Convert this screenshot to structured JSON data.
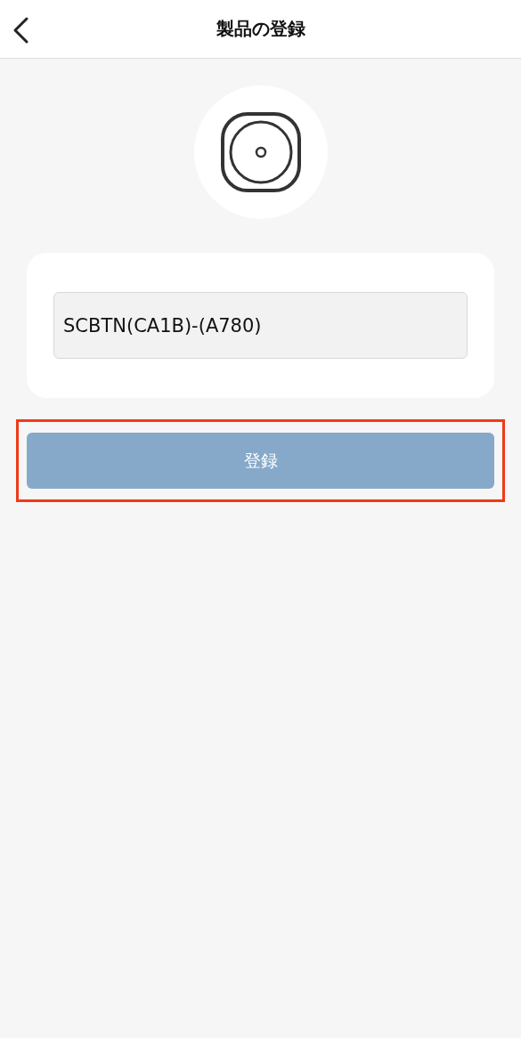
{
  "header": {
    "title": "製品の登録"
  },
  "form": {
    "serial_field": {
      "value": "SCBTN(CA1B)-(A780)"
    }
  },
  "register_button": {
    "label": "登録",
    "highlighted": true
  }
}
